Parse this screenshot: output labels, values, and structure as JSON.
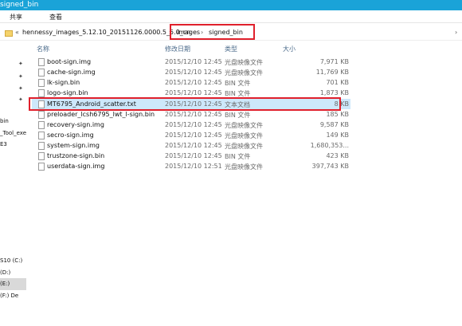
{
  "window": {
    "title": "signed_bin"
  },
  "ribbon": {
    "share": "共享",
    "view": "查看"
  },
  "address": {
    "back": "«",
    "path": [
      "hennessy_images_5.12.10_20151126.0000.5_5.0_cn",
      "images",
      "signed_bin"
    ],
    "separator": "›",
    "expand": "›"
  },
  "nav": {
    "items": [
      "bin",
      "_Tool_exe",
      "E3",
      "S10 (C:)",
      "(D:)",
      "(E:)",
      "(F:) De"
    ]
  },
  "columns": {
    "name": "名称",
    "date": "修改日期",
    "type": "类型",
    "size": "大小"
  },
  "files": [
    {
      "name": "boot-sign.img",
      "date": "2015/12/10 12:45",
      "type": "光盘映像文件",
      "size": "7,971 KB"
    },
    {
      "name": "cache-sign.img",
      "date": "2015/12/10 12:45",
      "type": "光盘映像文件",
      "size": "11,769 KB"
    },
    {
      "name": "lk-sign.bin",
      "date": "2015/12/10 12:45",
      "type": "BIN 文件",
      "size": "701 KB"
    },
    {
      "name": "logo-sign.bin",
      "date": "2015/12/10 12:45",
      "type": "BIN 文件",
      "size": "1,873 KB"
    },
    {
      "name": "MT6795_Android_scatter.txt",
      "date": "2015/12/10 12:45",
      "type": "文本文档",
      "size": "8 KB"
    },
    {
      "name": "preloader_lcsh6795_lwt_l-sign.bin",
      "date": "2015/12/10 12:45",
      "type": "BIN 文件",
      "size": "185 KB"
    },
    {
      "name": "recovery-sign.img",
      "date": "2015/12/10 12:45",
      "type": "光盘映像文件",
      "size": "9,587 KB"
    },
    {
      "name": "secro-sign.img",
      "date": "2015/12/10 12:45",
      "type": "光盘映像文件",
      "size": "149 KB"
    },
    {
      "name": "system-sign.img",
      "date": "2015/12/10 12:45",
      "type": "光盘映像文件",
      "size": "1,680,353..."
    },
    {
      "name": "trustzone-sign.bin",
      "date": "2015/12/10 12:45",
      "type": "BIN 文件",
      "size": "423 KB"
    },
    {
      "name": "userdata-sign.img",
      "date": "2015/12/10 12:51",
      "type": "光盘映像文件",
      "size": "397,743 KB"
    }
  ],
  "colors": {
    "titlebar": "#1aa3d8",
    "selection": "#cde8fb",
    "highlight": "#e0202c"
  }
}
